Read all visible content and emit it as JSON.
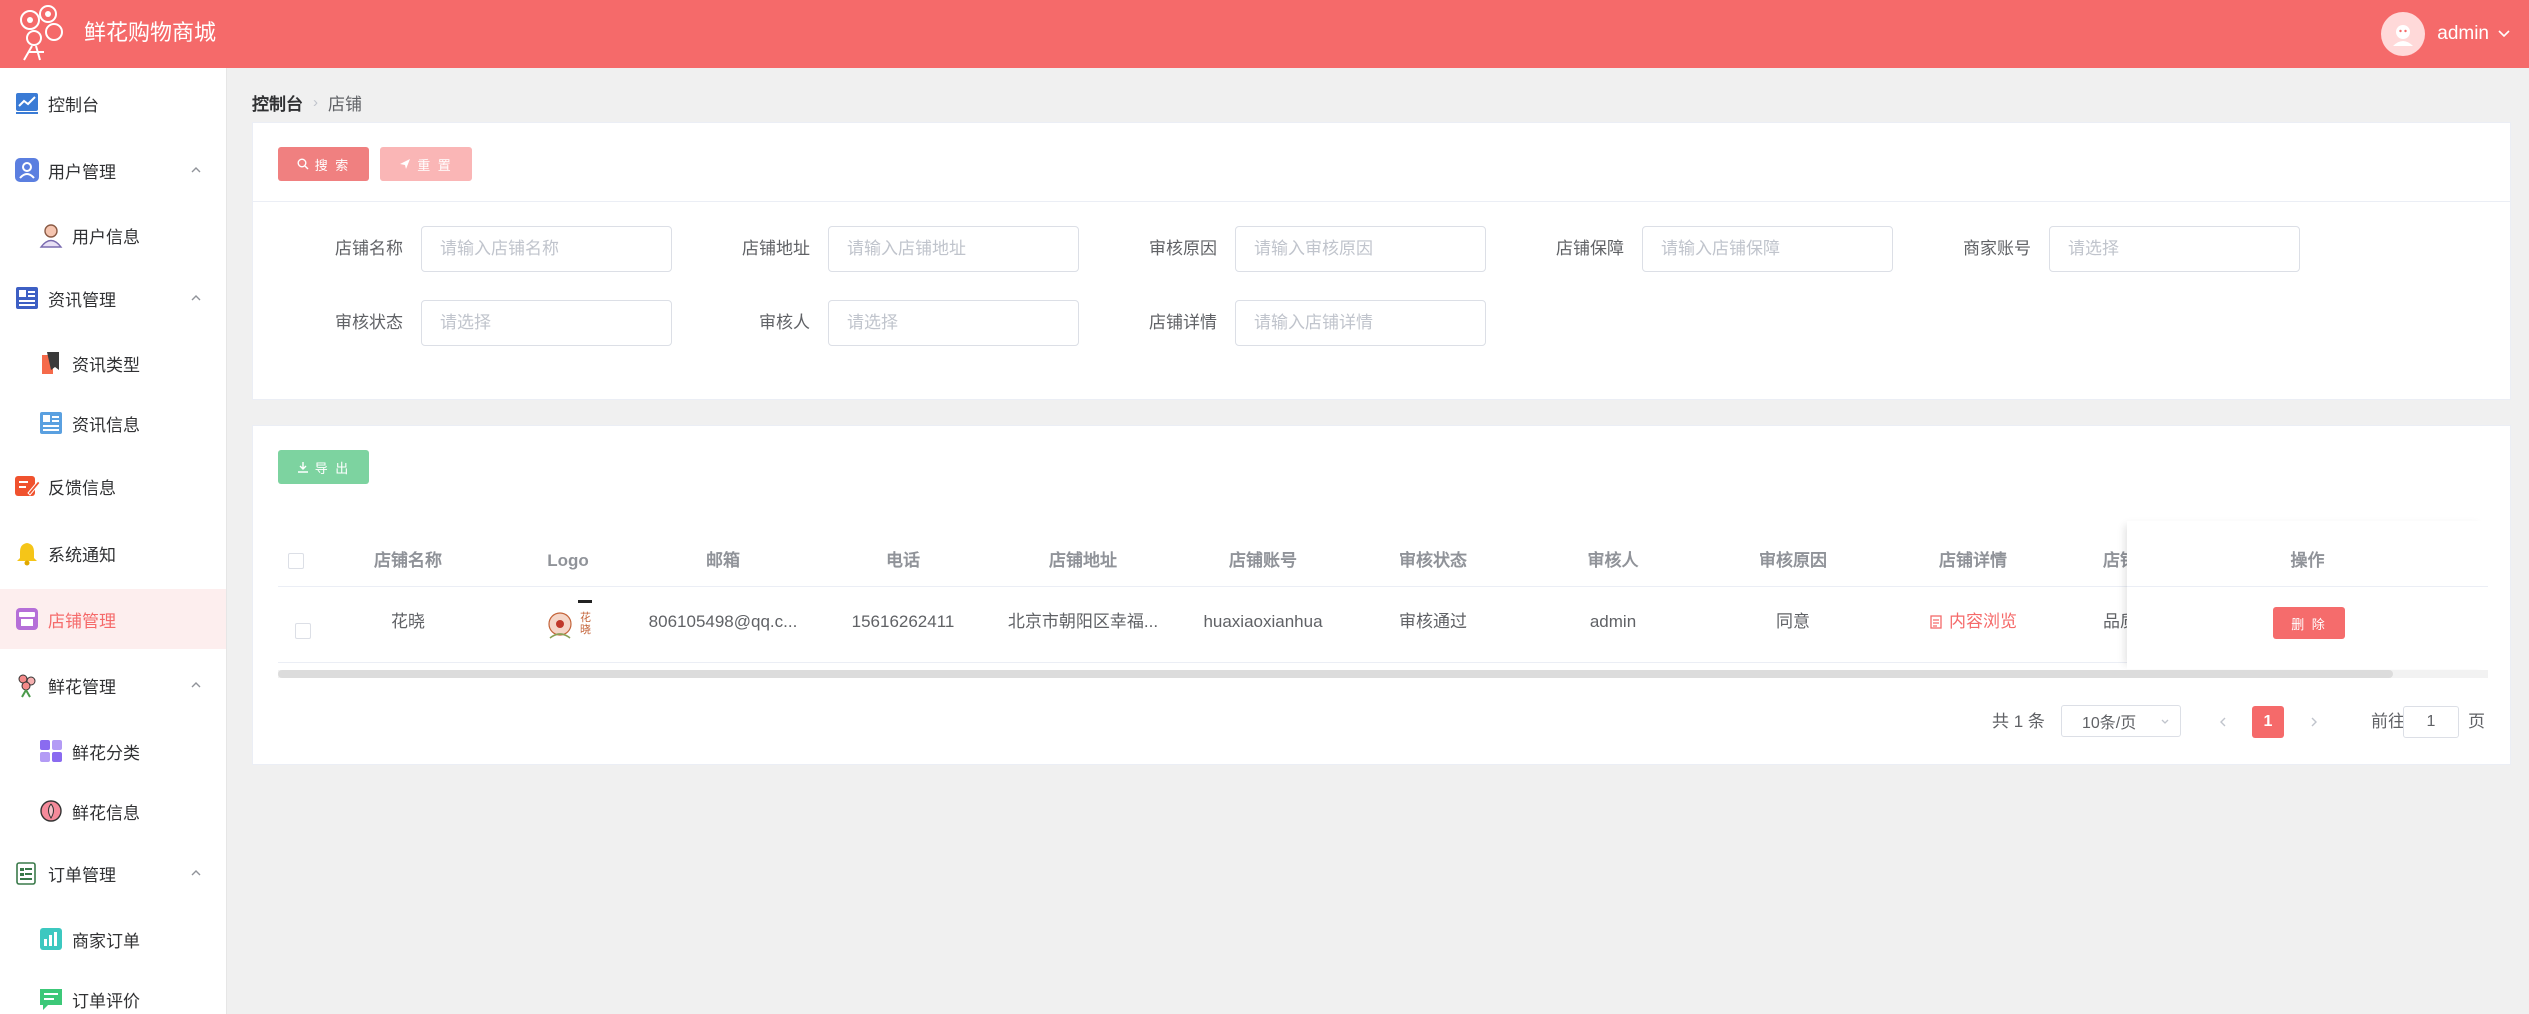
{
  "header": {
    "title": "鲜花购物商城",
    "user": "admin"
  },
  "sidebar": {
    "items": [
      {
        "label": "控制台"
      },
      {
        "label": "用户管理"
      },
      {
        "label": "用户信息"
      },
      {
        "label": "资讯管理"
      },
      {
        "label": "资讯类型"
      },
      {
        "label": "资讯信息"
      },
      {
        "label": "反馈信息"
      },
      {
        "label": "系统通知"
      },
      {
        "label": "店铺管理"
      },
      {
        "label": "鲜花管理"
      },
      {
        "label": "鲜花分类"
      },
      {
        "label": "鲜花信息"
      },
      {
        "label": "订单管理"
      },
      {
        "label": "商家订单"
      },
      {
        "label": "订单评价"
      }
    ]
  },
  "breadcrumb": {
    "home": "控制台",
    "current": "店铺"
  },
  "search": {
    "search_label": "搜 索",
    "reset_label": "重 置",
    "fields": [
      {
        "label": "店铺名称",
        "placeholder": "请输入店铺名称",
        "value": ""
      },
      {
        "label": "店铺地址",
        "placeholder": "请输入店铺地址",
        "value": ""
      },
      {
        "label": "审核原因",
        "placeholder": "请输入审核原因",
        "value": ""
      },
      {
        "label": "店铺保障",
        "placeholder": "请输入店铺保障",
        "value": ""
      },
      {
        "label": "商家账号",
        "placeholder": "请选择",
        "value": ""
      },
      {
        "label": "审核状态",
        "placeholder": "请选择",
        "value": ""
      },
      {
        "label": "审核人",
        "placeholder": "请选择",
        "value": ""
      },
      {
        "label": "店铺详情",
        "placeholder": "请输入店铺详情",
        "value": ""
      }
    ]
  },
  "table": {
    "export_label": "导 出",
    "columns": [
      "店铺名称",
      "Logo",
      "邮箱",
      "电话",
      "店铺地址",
      "店铺账号",
      "审核状态",
      "审核人",
      "审核原因",
      "店铺详情",
      "店铺",
      "操作"
    ],
    "rows": [
      {
        "name": "花晓",
        "email": "806105498@qq.c...",
        "phone": "15616262411",
        "address": "北京市朝阳区幸福...",
        "account": "huaxiaoxianhua",
        "status": "审核通过",
        "auditor": "admin",
        "reason": "同意",
        "detail": "内容浏览",
        "guarantee": "品质",
        "logo_text": "花晓",
        "delete_label": "删 除"
      }
    ]
  },
  "pagination": {
    "total_text": "共 1 条",
    "page_size": "10条/页",
    "current_page": "1",
    "goto_prefix": "前往",
    "goto_value": "1",
    "goto_suffix": "页"
  },
  "colors": {
    "brand": "#f56a6a",
    "export": "#7dd3a0"
  }
}
